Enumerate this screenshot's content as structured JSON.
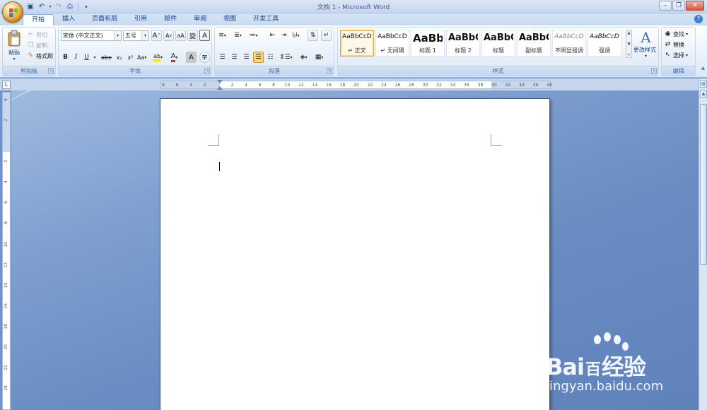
{
  "window": {
    "title": "文档 1 - Microsoft Word",
    "minimize": "–",
    "restore": "❐",
    "close": "✕"
  },
  "quick_access": [
    "save-icon",
    "undo-icon",
    "redo-icon",
    "print-preview-icon",
    "customize-icon"
  ],
  "tabs": [
    {
      "label": "开始",
      "active": true
    },
    {
      "label": "插入",
      "active": false
    },
    {
      "label": "页面布局",
      "active": false
    },
    {
      "label": "引用",
      "active": false
    },
    {
      "label": "邮件",
      "active": false
    },
    {
      "label": "审阅",
      "active": false
    },
    {
      "label": "视图",
      "active": false
    },
    {
      "label": "开发工具",
      "active": false
    }
  ],
  "clipboard": {
    "paste": "粘贴",
    "cut": "剪切",
    "copy": "复制",
    "format_painter": "格式刷",
    "label": "剪贴板"
  },
  "font": {
    "name": "宋体 (中文正文)",
    "size": "五号",
    "label": "字体",
    "grow": "A",
    "shrink": "A",
    "clear": "aA",
    "phonetic": "變",
    "border": "A",
    "bold": "B",
    "italic": "I",
    "underline": "U",
    "strike": "abe",
    "subscript": "x₂",
    "superscript": "x²",
    "case": "Aa",
    "highlight": "ab",
    "color": "A",
    "shading": "A",
    "enclose": "字"
  },
  "paragraph": {
    "label": "段落"
  },
  "styles": {
    "label": "样式",
    "change_styles": "更改样式",
    "items": [
      {
        "preview": "AaBbCcDd",
        "name": "↵ 正文",
        "active": true
      },
      {
        "preview": "AaBbCcDd",
        "name": "↵ 无间隔",
        "active": false
      },
      {
        "preview": "AaBb",
        "name": "标题 1",
        "active": false
      },
      {
        "preview": "AaBbC",
        "name": "标题 2",
        "active": false
      },
      {
        "preview": "AaBbC",
        "name": "标题",
        "active": false
      },
      {
        "preview": "AaBbC",
        "name": "副标题",
        "active": false
      },
      {
        "preview": "AaBbCcDd",
        "name": "不明显强调",
        "active": false
      },
      {
        "preview": "AaBbCcDd",
        "name": "强调",
        "active": false
      }
    ]
  },
  "editing": {
    "find": "查找",
    "replace": "替换",
    "select": "选择",
    "label": "编辑"
  },
  "ruler": {
    "ticks": [
      "8",
      "6",
      "4",
      "2",
      "",
      "2",
      "4",
      "6",
      "8",
      "10",
      "12",
      "14",
      "16",
      "18",
      "20",
      "22",
      "24",
      "26",
      "28",
      "30",
      "32",
      "34",
      "36",
      "38",
      "40",
      "42",
      "44",
      "46",
      "48"
    ]
  },
  "vruler": {
    "ticks": [
      "4",
      "2",
      "",
      "2",
      "4",
      "6",
      "8",
      "10",
      "12",
      "14",
      "16",
      "18",
      "20",
      "22",
      "24"
    ]
  },
  "watermark": {
    "brand": "Bai",
    "brand2": "百",
    "brand3": "经验",
    "url": "jingyan.baidu.com"
  }
}
